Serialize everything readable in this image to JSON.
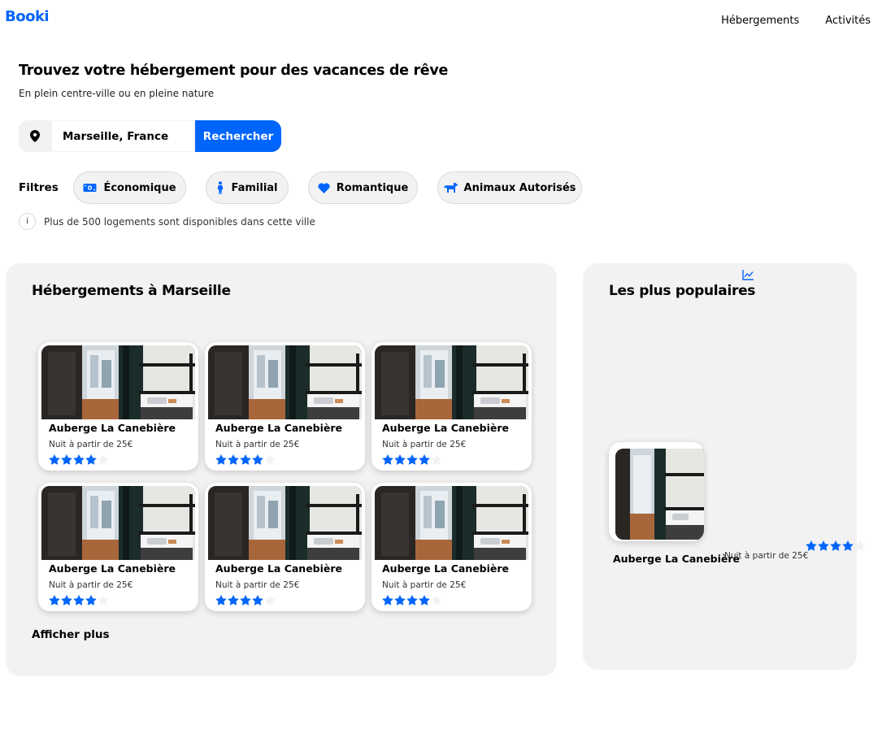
{
  "header": {
    "logo": "Booki",
    "nav": [
      "Hébergements",
      "Activités"
    ]
  },
  "hero": {
    "title": "Trouvez votre hébergement pour des vacances de rêve",
    "subtitle": "En plein centre-ville ou en pleine nature"
  },
  "search": {
    "icon": "map-pin-icon",
    "value": "Marseille, France",
    "button_label": "Rechercher"
  },
  "filters": {
    "label": "Filtres",
    "items": [
      {
        "label": "Économique",
        "icon": "money-icon"
      },
      {
        "label": "Familial",
        "icon": "child-icon"
      },
      {
        "label": "Romantique",
        "icon": "heart-icon"
      },
      {
        "label": "Animaux Autorisés",
        "icon": "dog-icon"
      }
    ]
  },
  "info": {
    "icon": "info-icon",
    "text": "Plus de 500 logements sont disponibles dans cette ville"
  },
  "accommodations": {
    "title": "Hébergements à Marseille",
    "cards": [
      {
        "name": "Auberge La Canebière",
        "price": "Nuit à partir de 25€",
        "rating": 4
      },
      {
        "name": "Auberge La Canebière",
        "price": "Nuit à partir de 25€",
        "rating": 4
      },
      {
        "name": "Auberge La Canebière",
        "price": "Nuit à partir de 25€",
        "rating": 4
      },
      {
        "name": "Auberge La Canebière",
        "price": "Nuit à partir de 25€",
        "rating": 4
      },
      {
        "name": "Auberge La Canebière",
        "price": "Nuit à partir de 25€",
        "rating": 4
      },
      {
        "name": "Auberge La Canebière",
        "price": "Nuit à partir de 25€",
        "rating": 4
      }
    ],
    "more_label": "Afficher plus"
  },
  "popular": {
    "title": "Les plus populaires",
    "icon": "chart-line-icon",
    "card": {
      "name": "Auberge La Canebière",
      "price": "Nuit à partir de 25€",
      "rating": 4
    }
  },
  "colors": {
    "accent": "#0065fc",
    "panel_bg": "#f2f2f2",
    "star_empty": "#f2f2f2"
  }
}
